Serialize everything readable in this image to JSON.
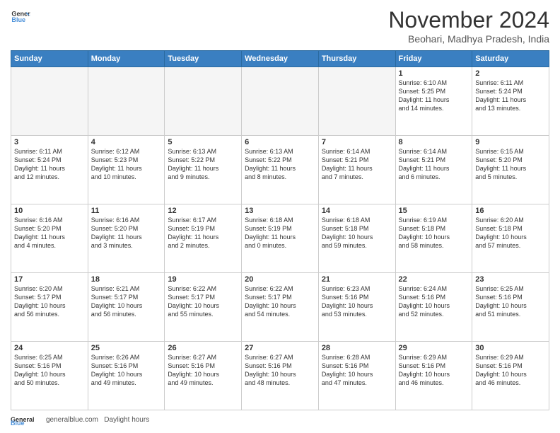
{
  "header": {
    "logo_line1": "General",
    "logo_line2": "Blue",
    "month_title": "November 2024",
    "location": "Beohari, Madhya Pradesh, India"
  },
  "footer": {
    "url": "GeneralBlue.com",
    "daylight_label": "Daylight hours"
  },
  "days_of_week": [
    "Sunday",
    "Monday",
    "Tuesday",
    "Wednesday",
    "Thursday",
    "Friday",
    "Saturday"
  ],
  "weeks": [
    {
      "days": [
        {
          "num": "",
          "info": "",
          "empty": true
        },
        {
          "num": "",
          "info": "",
          "empty": true
        },
        {
          "num": "",
          "info": "",
          "empty": true
        },
        {
          "num": "",
          "info": "",
          "empty": true
        },
        {
          "num": "",
          "info": "",
          "empty": true
        },
        {
          "num": "1",
          "info": "Sunrise: 6:10 AM\nSunset: 5:25 PM\nDaylight: 11 hours\nand 14 minutes.",
          "empty": false
        },
        {
          "num": "2",
          "info": "Sunrise: 6:11 AM\nSunset: 5:24 PM\nDaylight: 11 hours\nand 13 minutes.",
          "empty": false
        }
      ]
    },
    {
      "days": [
        {
          "num": "3",
          "info": "Sunrise: 6:11 AM\nSunset: 5:24 PM\nDaylight: 11 hours\nand 12 minutes.",
          "empty": false
        },
        {
          "num": "4",
          "info": "Sunrise: 6:12 AM\nSunset: 5:23 PM\nDaylight: 11 hours\nand 10 minutes.",
          "empty": false
        },
        {
          "num": "5",
          "info": "Sunrise: 6:13 AM\nSunset: 5:22 PM\nDaylight: 11 hours\nand 9 minutes.",
          "empty": false
        },
        {
          "num": "6",
          "info": "Sunrise: 6:13 AM\nSunset: 5:22 PM\nDaylight: 11 hours\nand 8 minutes.",
          "empty": false
        },
        {
          "num": "7",
          "info": "Sunrise: 6:14 AM\nSunset: 5:21 PM\nDaylight: 11 hours\nand 7 minutes.",
          "empty": false
        },
        {
          "num": "8",
          "info": "Sunrise: 6:14 AM\nSunset: 5:21 PM\nDaylight: 11 hours\nand 6 minutes.",
          "empty": false
        },
        {
          "num": "9",
          "info": "Sunrise: 6:15 AM\nSunset: 5:20 PM\nDaylight: 11 hours\nand 5 minutes.",
          "empty": false
        }
      ]
    },
    {
      "days": [
        {
          "num": "10",
          "info": "Sunrise: 6:16 AM\nSunset: 5:20 PM\nDaylight: 11 hours\nand 4 minutes.",
          "empty": false
        },
        {
          "num": "11",
          "info": "Sunrise: 6:16 AM\nSunset: 5:20 PM\nDaylight: 11 hours\nand 3 minutes.",
          "empty": false
        },
        {
          "num": "12",
          "info": "Sunrise: 6:17 AM\nSunset: 5:19 PM\nDaylight: 11 hours\nand 2 minutes.",
          "empty": false
        },
        {
          "num": "13",
          "info": "Sunrise: 6:18 AM\nSunset: 5:19 PM\nDaylight: 11 hours\nand 0 minutes.",
          "empty": false
        },
        {
          "num": "14",
          "info": "Sunrise: 6:18 AM\nSunset: 5:18 PM\nDaylight: 10 hours\nand 59 minutes.",
          "empty": false
        },
        {
          "num": "15",
          "info": "Sunrise: 6:19 AM\nSunset: 5:18 PM\nDaylight: 10 hours\nand 58 minutes.",
          "empty": false
        },
        {
          "num": "16",
          "info": "Sunrise: 6:20 AM\nSunset: 5:18 PM\nDaylight: 10 hours\nand 57 minutes.",
          "empty": false
        }
      ]
    },
    {
      "days": [
        {
          "num": "17",
          "info": "Sunrise: 6:20 AM\nSunset: 5:17 PM\nDaylight: 10 hours\nand 56 minutes.",
          "empty": false
        },
        {
          "num": "18",
          "info": "Sunrise: 6:21 AM\nSunset: 5:17 PM\nDaylight: 10 hours\nand 56 minutes.",
          "empty": false
        },
        {
          "num": "19",
          "info": "Sunrise: 6:22 AM\nSunset: 5:17 PM\nDaylight: 10 hours\nand 55 minutes.",
          "empty": false
        },
        {
          "num": "20",
          "info": "Sunrise: 6:22 AM\nSunset: 5:17 PM\nDaylight: 10 hours\nand 54 minutes.",
          "empty": false
        },
        {
          "num": "21",
          "info": "Sunrise: 6:23 AM\nSunset: 5:16 PM\nDaylight: 10 hours\nand 53 minutes.",
          "empty": false
        },
        {
          "num": "22",
          "info": "Sunrise: 6:24 AM\nSunset: 5:16 PM\nDaylight: 10 hours\nand 52 minutes.",
          "empty": false
        },
        {
          "num": "23",
          "info": "Sunrise: 6:25 AM\nSunset: 5:16 PM\nDaylight: 10 hours\nand 51 minutes.",
          "empty": false
        }
      ]
    },
    {
      "days": [
        {
          "num": "24",
          "info": "Sunrise: 6:25 AM\nSunset: 5:16 PM\nDaylight: 10 hours\nand 50 minutes.",
          "empty": false
        },
        {
          "num": "25",
          "info": "Sunrise: 6:26 AM\nSunset: 5:16 PM\nDaylight: 10 hours\nand 49 minutes.",
          "empty": false
        },
        {
          "num": "26",
          "info": "Sunrise: 6:27 AM\nSunset: 5:16 PM\nDaylight: 10 hours\nand 49 minutes.",
          "empty": false
        },
        {
          "num": "27",
          "info": "Sunrise: 6:27 AM\nSunset: 5:16 PM\nDaylight: 10 hours\nand 48 minutes.",
          "empty": false
        },
        {
          "num": "28",
          "info": "Sunrise: 6:28 AM\nSunset: 5:16 PM\nDaylight: 10 hours\nand 47 minutes.",
          "empty": false
        },
        {
          "num": "29",
          "info": "Sunrise: 6:29 AM\nSunset: 5:16 PM\nDaylight: 10 hours\nand 46 minutes.",
          "empty": false
        },
        {
          "num": "30",
          "info": "Sunrise: 6:29 AM\nSunset: 5:16 PM\nDaylight: 10 hours\nand 46 minutes.",
          "empty": false
        }
      ]
    }
  ]
}
